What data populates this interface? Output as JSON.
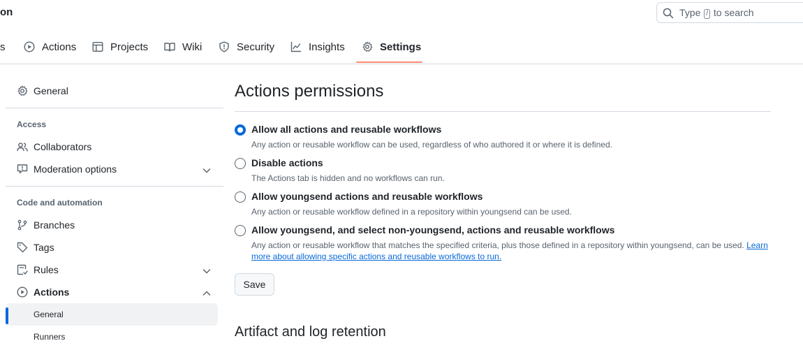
{
  "header": {
    "repo_title": "on",
    "search": {
      "prefix": "Type",
      "key": "/",
      "suffix": "to search"
    }
  },
  "tabs": [
    {
      "label": "s",
      "icon": "truncated-tab"
    },
    {
      "label": "Actions",
      "icon": "play-icon"
    },
    {
      "label": "Projects",
      "icon": "table-icon"
    },
    {
      "label": "Wiki",
      "icon": "book-icon"
    },
    {
      "label": "Security",
      "icon": "shield-icon"
    },
    {
      "label": "Insights",
      "icon": "graph-icon"
    },
    {
      "label": "Settings",
      "icon": "gear-icon",
      "selected": true
    }
  ],
  "sidebar": {
    "general": "General",
    "access_heading": "Access",
    "collaborators": "Collaborators",
    "moderation": "Moderation options",
    "code_heading": "Code and automation",
    "branches": "Branches",
    "tags": "Tags",
    "rules": "Rules",
    "actions": "Actions",
    "actions_general": "General",
    "actions_runners": "Runners"
  },
  "main": {
    "title": "Actions permissions",
    "options": [
      {
        "label": "Allow all actions and reusable workflows",
        "desc": "Any action or reusable workflow can be used, regardless of who authored it or where it is defined.",
        "checked": true
      },
      {
        "label": "Disable actions",
        "desc": "The Actions tab is hidden and no workflows can run.",
        "checked": false
      },
      {
        "label": "Allow youngsend actions and reusable workflows",
        "desc": "Any action or reusable workflow defined in a repository within youngsend can be used.",
        "checked": false
      },
      {
        "label": "Allow youngsend, and select non-youngsend, actions and reusable workflows",
        "desc": "Any action or reusable workflow that matches the specified criteria, plus those defined in a repository within youngsend, can be used.",
        "link": "Learn more about allowing specific actions and reusable workflows to run.",
        "checked": false
      }
    ],
    "save_label": "Save",
    "artifact_title": "Artifact and log retention"
  },
  "colors": {
    "accent": "#0969da",
    "tab_underline": "#fd8c73",
    "muted": "#59636e",
    "border": "#d1d9e0"
  }
}
